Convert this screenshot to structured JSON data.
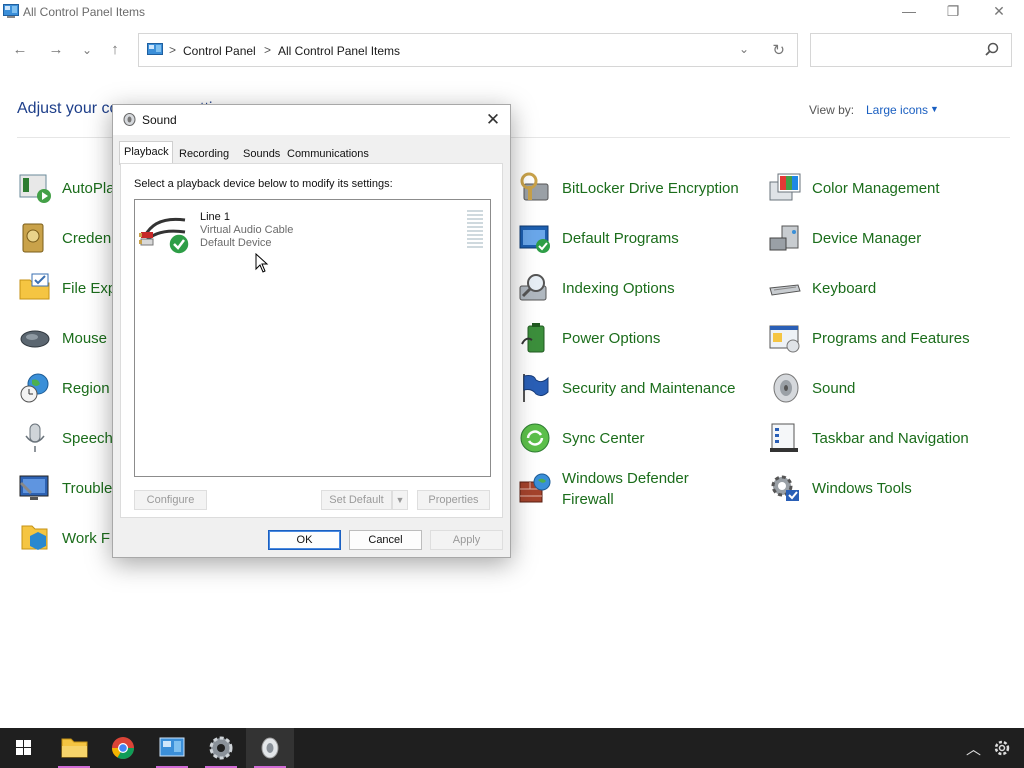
{
  "window": {
    "title": "All Control Panel Items"
  },
  "controls": {
    "minimize": "—",
    "restore": "❐",
    "close": "✕"
  },
  "nav": {
    "back": "←",
    "forward": "→",
    "recent": "⌄",
    "up": "↑"
  },
  "address": {
    "crumbs": [
      "Control Panel",
      "All Control Panel Items"
    ],
    "separator": ">"
  },
  "search": {
    "placeholder": ""
  },
  "page": {
    "heading": "Adjust your co",
    "heading_tail": "ttin",
    "viewby_label": "View by:",
    "viewby_value": "Large icons"
  },
  "items_col1": [
    {
      "label": "AutoPla",
      "icon": "autoplay-icon"
    },
    {
      "label": "Creden",
      "icon": "credential-manager-icon"
    },
    {
      "label": "File Exp",
      "icon": "file-explorer-icon"
    },
    {
      "label": "Mouse",
      "icon": "mouse-icon"
    },
    {
      "label": "Region",
      "icon": "region-icon"
    },
    {
      "label": "Speech",
      "icon": "speech-icon"
    },
    {
      "label": "Trouble",
      "icon": "troubleshooting-icon"
    },
    {
      "label": "Work F",
      "icon": "work-folders-icon"
    }
  ],
  "items_col3": [
    {
      "label": "BitLocker Drive Encryption",
      "icon": "bitlocker-icon"
    },
    {
      "label": "Default Programs",
      "icon": "default-programs-icon"
    },
    {
      "label": "Indexing Options",
      "icon": "indexing-icon"
    },
    {
      "label": "Power Options",
      "icon": "power-icon"
    },
    {
      "label": "Security and Maintenance",
      "icon": "security-flag-icon"
    },
    {
      "label": "Sync Center",
      "icon": "sync-icon"
    },
    {
      "label": "Windows Defender Firewall",
      "icon": "firewall-icon"
    }
  ],
  "items_col4": [
    {
      "label": "Color Management",
      "icon": "color-management-icon"
    },
    {
      "label": "Device Manager",
      "icon": "device-manager-icon"
    },
    {
      "label": "Keyboard",
      "icon": "keyboard-icon"
    },
    {
      "label": "Programs and Features",
      "icon": "programs-features-icon"
    },
    {
      "label": "Sound",
      "icon": "sound-icon"
    },
    {
      "label": "Taskbar and Navigation",
      "icon": "taskbar-icon"
    },
    {
      "label": "Windows Tools",
      "icon": "windows-tools-icon"
    }
  ],
  "dialog": {
    "title": "Sound",
    "close": "✕",
    "tabs": [
      "Playback",
      "Recording",
      "Sounds",
      "Communications"
    ],
    "instruction": "Select a playback device below to modify its settings:",
    "device": {
      "name": "Line 1",
      "description": "Virtual Audio Cable",
      "status": "Default Device"
    },
    "buttons": {
      "configure": "Configure",
      "set_default": "Set Default",
      "properties": "Properties",
      "ok": "OK",
      "cancel": "Cancel",
      "apply": "Apply"
    }
  },
  "taskbar": {
    "apps": [
      "start-icon",
      "file-explorer-icon",
      "chrome-icon",
      "control-panel-icon",
      "settings-icon",
      "sound-icon"
    ]
  },
  "colors": {
    "link_green": "#1b6d1b",
    "heading_blue": "#1e3f8a",
    "accent": "#1a5fc1",
    "taskbar": "#1f1f1f"
  }
}
